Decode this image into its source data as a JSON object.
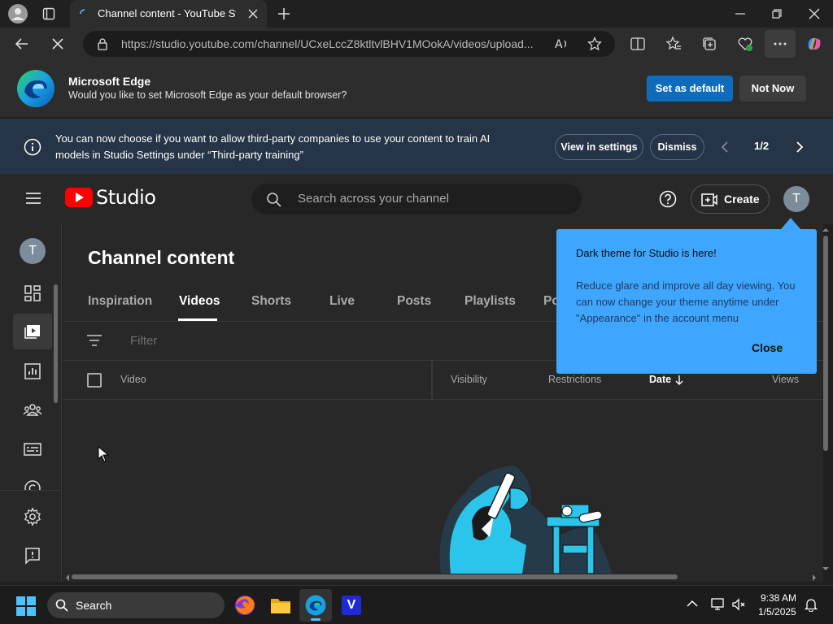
{
  "browser": {
    "tab_title": "Channel content - YouTube Studio",
    "url": "https://studio.youtube.com/channel/UCxeLccZ8ktltvlBHV1MOokA/videos/upload..."
  },
  "default_bar": {
    "title": "Microsoft Edge",
    "subtitle": "Would you like to set Microsoft Edge as your default browser?",
    "set_default": "Set as default",
    "not_now": "Not Now"
  },
  "notice": {
    "text": "You can now choose if you want to allow third-party companies to use your content to train AI models in Studio Settings under “Third-party training”",
    "view_settings": "View in settings",
    "dismiss": "Dismiss",
    "pager": "1/2"
  },
  "header": {
    "logo": "Studio",
    "search_placeholder": "Search across your channel",
    "create": "Create",
    "avatar_letter": "T"
  },
  "main": {
    "title": "Channel content",
    "tabs": [
      "Inspiration",
      "Videos",
      "Shorts",
      "Live",
      "Posts",
      "Playlists",
      "Po"
    ],
    "active_tab": "Videos",
    "filter": "Filter",
    "columns": [
      "Video",
      "Visibility",
      "Restrictions",
      "Date",
      "Views"
    ]
  },
  "popup": {
    "title": "Dark theme for Studio is here!",
    "body": "Reduce glare and improve all day viewing. You can now change your theme anytime under \"Appearance\" in the account menu",
    "close": "Close"
  },
  "taskbar": {
    "search": "Search",
    "time": "9:38 AM",
    "date": "1/5/2025"
  },
  "colors": {
    "accent_blue": "#3ea6ff",
    "edge_button": "#0f6cbd",
    "youtube_red": "#ff0000",
    "illustration_cyan": "#2bc4ea"
  }
}
